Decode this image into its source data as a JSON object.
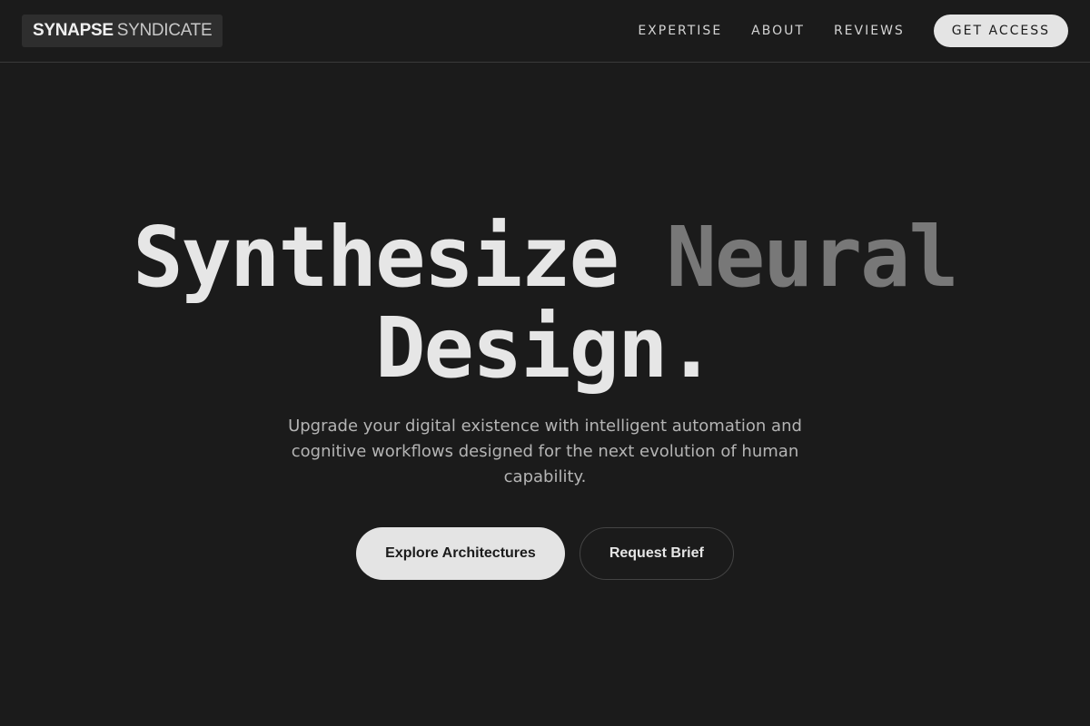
{
  "header": {
    "logo": {
      "strong": "SYNAPSE",
      "light": "SYNDICATE"
    },
    "nav": {
      "expertise": "EXPERTISE",
      "about": "ABOUT",
      "reviews": "REVIEWS"
    },
    "cta": "GET ACCESS"
  },
  "hero": {
    "title_part1": "Synthesize ",
    "title_part2": "Neural",
    "title_line2": "Design.",
    "subtitle": "Upgrade your digital existence with intelligent automation and cognitive workflows designed for the next evolution of human capability.",
    "primary_button": "Explore Architectures",
    "secondary_button": "Request Brief"
  },
  "colors": {
    "background": "#1b1b1b",
    "title_primary": "#e6e6e6",
    "title_muted": "#787878",
    "button_fill": "#e4e4e4"
  }
}
